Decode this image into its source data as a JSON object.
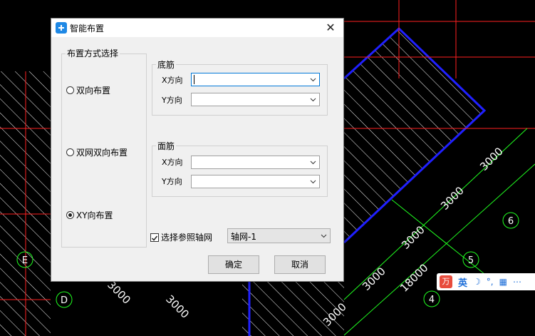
{
  "dialog": {
    "title": "智能布置",
    "close_glyph": "✕",
    "layout_group": {
      "title": "布置方式选择",
      "options": [
        {
          "label": "双向布置",
          "selected": false
        },
        {
          "label": "双网双向布置",
          "selected": false
        },
        {
          "label": "XY向布置",
          "selected": true
        }
      ]
    },
    "bottom_rebar": {
      "title": "底筋",
      "x_label": "X方向",
      "y_label": "Y方向",
      "x_value": "",
      "y_value": ""
    },
    "top_rebar": {
      "title": "面筋",
      "x_label": "X方向",
      "y_label": "Y方向",
      "x_value": "",
      "y_value": ""
    },
    "grid_ref": {
      "label": "选择参照轴网",
      "checked": true,
      "value": "轴网-1"
    },
    "ok_label": "确定",
    "cancel_label": "取消"
  },
  "cad": {
    "dims": [
      "3000",
      "3000",
      "3000",
      "3000",
      "18000",
      "3000",
      "3000",
      "3000"
    ],
    "axis_labels": [
      "6",
      "5",
      "4",
      "E",
      "D"
    ]
  },
  "ime": {
    "logo": "万",
    "lang": "英",
    "sym1": "☽",
    "sym2": "°,",
    "sym3": "▦",
    "sym4": "⋯"
  },
  "colors": {
    "accent": "#0078d7",
    "cad_red": "#ff2020",
    "cad_green": "#20ff20",
    "cad_blue": "#2020ff",
    "cad_hatch": "#ffffff"
  }
}
